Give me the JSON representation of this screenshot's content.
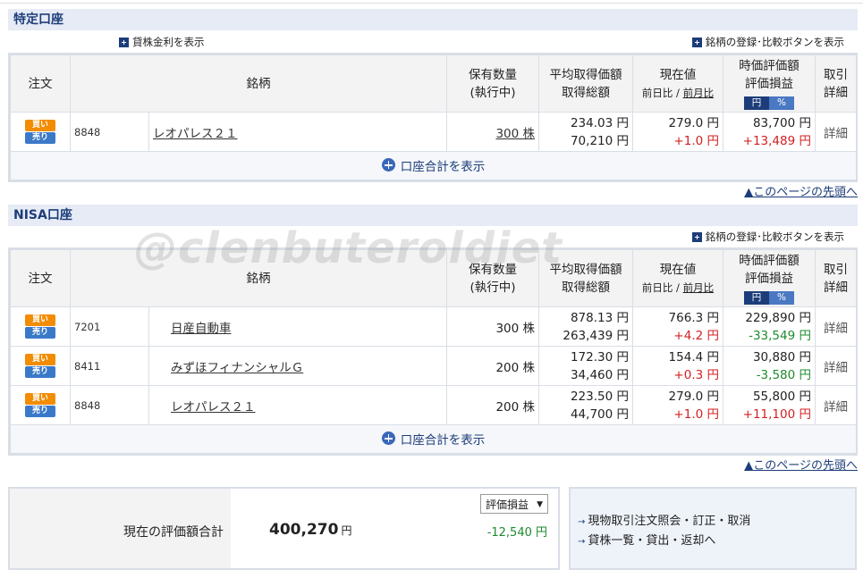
{
  "sections": [
    {
      "title": "特定口座",
      "toggle_lending": "貸株金利を表示",
      "toggle_compare": "銘柄の登録･比較ボタンを表示",
      "rows": [
        {
          "code": "8848",
          "name": "レオパレス２１",
          "shares": "300 株",
          "avg_price": "234.03 円",
          "avg_total": "70,210 円",
          "price": "279.0 円",
          "day_change": "+1.0 円",
          "mkt_value": "83,700 円",
          "pl": "+13,489 円",
          "detail": "詳細"
        }
      ],
      "sum_label": "口座合計を表示",
      "pagetop": "▲このページの先頭へ"
    },
    {
      "title": "NISA口座",
      "toggle_compare": "銘柄の登録･比較ボタンを表示",
      "rows": [
        {
          "code": "7201",
          "name": "日産自動車",
          "shares": "300 株",
          "avg_price": "878.13 円",
          "avg_total": "263,439 円",
          "price": "766.3 円",
          "day_change": "+4.2 円",
          "mkt_value": "229,890 円",
          "pl": "-33,549 円",
          "detail": "詳細"
        },
        {
          "code": "8411",
          "name": "みずほフィナンシャルＧ",
          "shares": "200 株",
          "avg_price": "172.30 円",
          "avg_total": "34,460 円",
          "price": "154.4 円",
          "day_change": "+0.3 円",
          "mkt_value": "30,880 円",
          "pl": "-3,580 円",
          "detail": "詳細"
        },
        {
          "code": "8848",
          "name": "レオパレス２１",
          "shares": "200 株",
          "avg_price": "223.50 円",
          "avg_total": "44,700 円",
          "price": "279.0 円",
          "day_change": "+1.0 円",
          "mkt_value": "55,800 円",
          "pl": "+11,100 円",
          "detail": "詳細"
        }
      ],
      "sum_label": "口座合計を表示",
      "pagetop": "▲このページの先頭へ"
    }
  ],
  "headers": {
    "order": "注文",
    "name": "銘柄",
    "shares_1": "保有数量",
    "shares_2": "(執行中)",
    "avg_1": "平均取得価額",
    "avg_2": "取得総額",
    "price_1": "現在値",
    "price_day": "前日比",
    "price_sep": " / ",
    "price_month": "前月比",
    "mkt_1": "時価評価額",
    "mkt_2": "評価損益",
    "mkt_yen": "円",
    "mkt_pct": "%",
    "detail_1": "取引",
    "detail_2": "詳細"
  },
  "buttons": {
    "buy": "買い",
    "sell": "売り"
  },
  "watermark": "@clenbuteroldiet",
  "total": {
    "label": "現在の評価額合計",
    "value": "400,270",
    "unit": "円",
    "select": "評価損益",
    "pl": "-12,540 円"
  },
  "links": [
    "現物取引注文照会・訂正・取消",
    "貸株一覧・貸出・返却へ"
  ],
  "colors": {
    "positive": "#d42020",
    "negative": "#1e8a2d",
    "accent": "#1d3d7a"
  }
}
